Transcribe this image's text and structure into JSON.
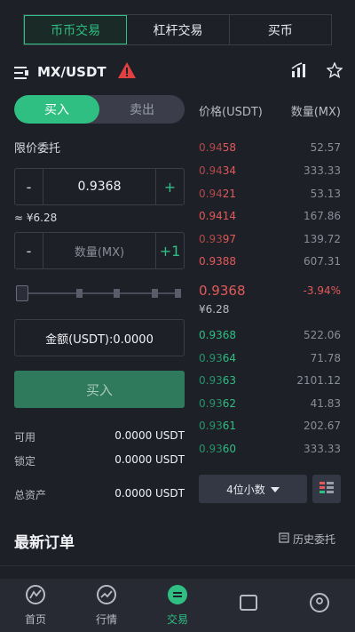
{
  "top_tabs": [
    {
      "label": "币币交易"
    },
    {
      "label": "杠杆交易"
    },
    {
      "label": "买币"
    }
  ],
  "pair": {
    "name": "MX/USDT",
    "icons": [
      "menu-icon",
      "warning-icon",
      "chart-icon",
      "star-icon"
    ]
  },
  "side_toggle": {
    "buy": "买入",
    "sell": "卖出"
  },
  "order_type": "限价委托",
  "price_input": {
    "minus": "-",
    "value": "0.9368",
    "plus": "+"
  },
  "price_cny": "≈ ¥6.28",
  "qty_input": {
    "minus": "-",
    "placeholder": "数量(MX)",
    "plus": "+1"
  },
  "slider": {
    "value_fraction": 0
  },
  "amount": "金额(USDT):0.0000",
  "buy_button": "买入",
  "balances": [
    {
      "label": "可用",
      "value": "0.0000 USDT"
    },
    {
      "label": "锁定",
      "value": "0.0000 USDT"
    },
    {
      "label": "总资产",
      "value": "0.0000 USDT"
    }
  ],
  "orderbook": {
    "price_header": "价格(USDT)",
    "qty_header": "数量(MX)",
    "asks": [
      {
        "price_base": "0.94",
        "price_tail": "58",
        "qty": "52.57"
      },
      {
        "price_base": "0.94",
        "price_tail": "34",
        "qty": "333.33"
      },
      {
        "price_base": "0.94",
        "price_tail": "21",
        "qty": "53.13"
      },
      {
        "price_base": "0.9414",
        "price_tail": "",
        "qty": "167.86"
      },
      {
        "price_base": "0.93",
        "price_tail": "97",
        "qty": "139.72"
      },
      {
        "price_base": "0.9388",
        "price_tail": "",
        "qty": "607.31"
      }
    ],
    "last_price": "0.9368",
    "last_change": "-3.94%",
    "last_cny": "¥6.28",
    "bids": [
      {
        "price_base": "0.9368",
        "price_tail": "",
        "qty": "522.06"
      },
      {
        "price_base": "0.93",
        "price_tail": "64",
        "qty": "71.78"
      },
      {
        "price_base": "0.93",
        "price_tail": "63",
        "qty": "2101.12"
      },
      {
        "price_base": "0.93",
        "price_tail": "62",
        "qty": "41.83"
      },
      {
        "price_base": "0.93",
        "price_tail": "61",
        "qty": "202.67"
      },
      {
        "price_base": "0.93",
        "price_tail": "60",
        "qty": "333.33"
      }
    ],
    "decimals": "4位小数"
  },
  "recent_orders": {
    "title": "最新订单",
    "history": "历史委托"
  },
  "bottom_nav": [
    {
      "label": "首页"
    },
    {
      "label": "行情"
    },
    {
      "label": "交易"
    },
    {
      "label": ""
    },
    {
      "label": ""
    }
  ],
  "colors": {
    "accent": "#2fbf83",
    "ask": "#e25a5a",
    "bg": "#1e2027"
  }
}
